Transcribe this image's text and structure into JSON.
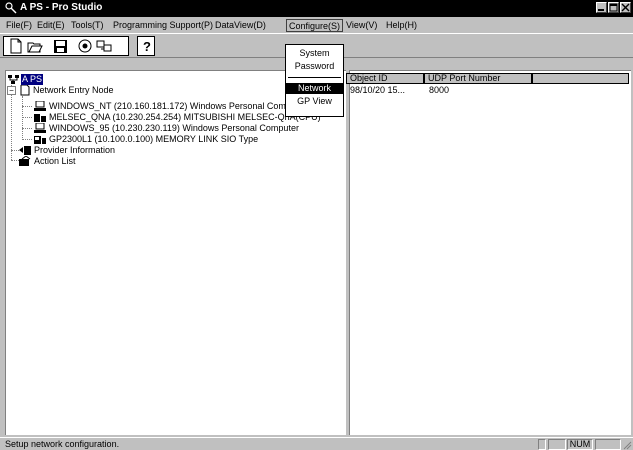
{
  "window": {
    "title": "A PS - Pro Studio"
  },
  "menubar": {
    "items": [
      {
        "label": "File(F)",
        "underline": "F"
      },
      {
        "label": "Edit(E)",
        "underline": "E"
      },
      {
        "label": "Tools(T)",
        "underline": "T"
      },
      {
        "label": "Programming Support(P)",
        "underline": "P"
      },
      {
        "label": "DataView(D)",
        "underline": "D"
      },
      {
        "label": "Configure(S)",
        "underline": "S"
      },
      {
        "label": "View(V)",
        "underline": "V"
      },
      {
        "label": "Help(H)",
        "underline": "H"
      }
    ]
  },
  "dropdown": {
    "items": [
      "System",
      "Password",
      "Network",
      "GP View"
    ],
    "highlighted": "Network"
  },
  "toolbar": {
    "buttons": [
      "new-icon",
      "open-icon",
      "save-icon",
      "view-icon",
      "transfer-icon",
      "help-icon"
    ]
  },
  "tree": {
    "root": "A PS",
    "network_entry": "Network Entry Node",
    "nodes": [
      "WINDOWS_NT (210.160.181.172) Windows Personal Computer",
      "MELSEC_QNA (10.230.254.254) MITSUBISHI MELSEC-QnA(CPU)",
      "WINDOWS_95 (10.230.230.119) Windows Personal Computer",
      "GP2300L1 (10.100.0.100) MEMORY LINK SIO Type"
    ],
    "provider": "Provider Information",
    "action": "Action List"
  },
  "table": {
    "columns": [
      "Object ID",
      "UDP Port Number",
      ""
    ],
    "rows": [
      [
        "98/10/20 15...",
        "8000"
      ]
    ]
  },
  "status": {
    "text": "Setup network configuration.",
    "num": "NUM"
  }
}
